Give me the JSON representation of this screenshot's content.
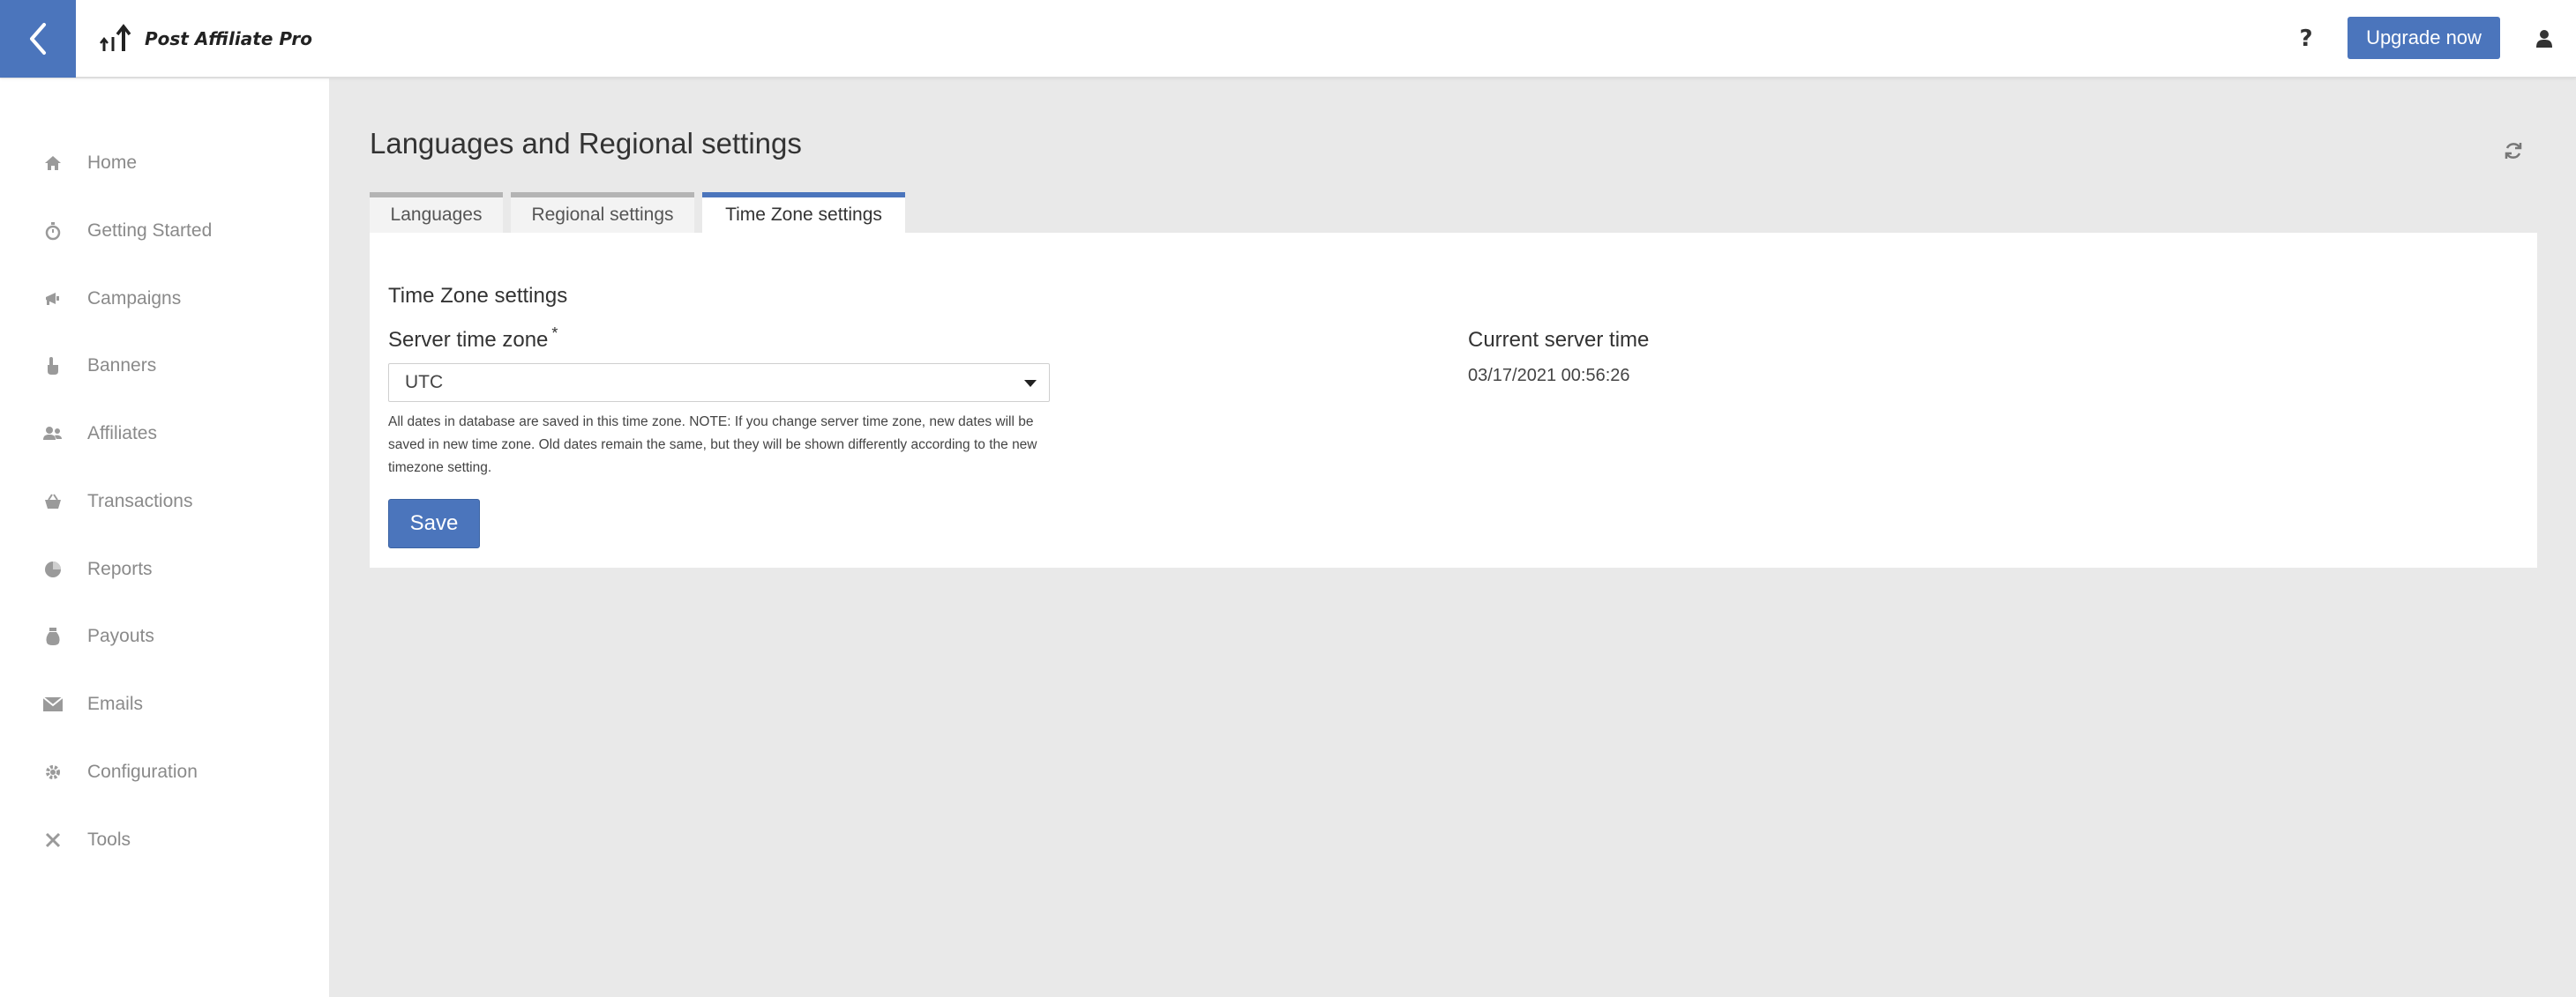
{
  "header": {
    "logo_text": "Post Affiliate Pro",
    "help_label": "?",
    "upgrade_label": "Upgrade now"
  },
  "sidebar": {
    "items": [
      {
        "label": "Home",
        "icon": "home-icon"
      },
      {
        "label": "Getting Started",
        "icon": "stopwatch-icon"
      },
      {
        "label": "Campaigns",
        "icon": "megaphone-icon"
      },
      {
        "label": "Banners",
        "icon": "pointer-hand-icon"
      },
      {
        "label": "Affiliates",
        "icon": "users-icon"
      },
      {
        "label": "Transactions",
        "icon": "basket-icon"
      },
      {
        "label": "Reports",
        "icon": "pie-chart-icon"
      },
      {
        "label": "Payouts",
        "icon": "money-bag-icon"
      },
      {
        "label": "Emails",
        "icon": "envelope-icon"
      },
      {
        "label": "Configuration",
        "icon": "gear-icon"
      },
      {
        "label": "Tools",
        "icon": "tools-icon"
      }
    ]
  },
  "main": {
    "title": "Languages and Regional settings",
    "tabs": [
      {
        "label": "Languages",
        "active": false
      },
      {
        "label": "Regional settings",
        "active": false
      },
      {
        "label": "Time Zone settings",
        "active": true
      }
    ],
    "section_title": "Time Zone settings",
    "server_time_zone": {
      "label": "Server time zone",
      "required_mark": "*",
      "value": "UTC",
      "help": "All dates in database are saved in this time zone. NOTE: If you change server time zone, new dates will be saved in new time zone. Old dates remain the same, but they will be shown differently according to the new timezone setting."
    },
    "save_label": "Save",
    "current_server_time": {
      "label": "Current server time",
      "value": "03/17/2021 00:56:26"
    }
  },
  "colors": {
    "accent": "#4b75bc",
    "background": "#e9e9e9",
    "sidebar_text": "#8a8a8a"
  }
}
